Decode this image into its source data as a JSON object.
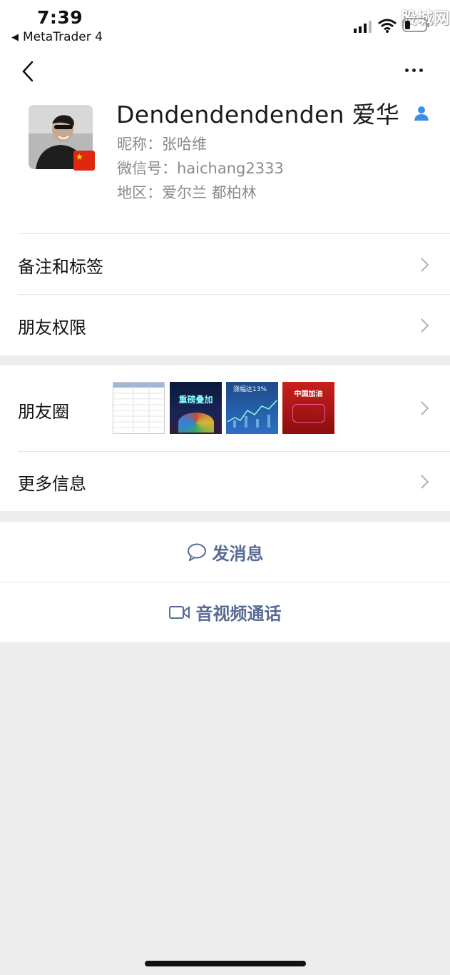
{
  "status_bar": {
    "time": "7:39",
    "back_app": "MetaTrader 4",
    "watermark": "股城网",
    "icons": [
      "signal-icon",
      "wifi-icon",
      "battery-icon"
    ]
  },
  "nav": {
    "back_icon": "chevron-left-icon",
    "more_icon": "more-dots-icon"
  },
  "profile": {
    "name": "Dendendendenden 爱华",
    "nickname": "昵称：张哈维",
    "wechat_id": "微信号：haichang2333",
    "region": "地区：爱尔兰 都柏林"
  },
  "rows": {
    "remarks": "备注和标签",
    "permissions": "朋友权限",
    "moments": "朋友圈",
    "more_info": "更多信息"
  },
  "moments_thumbs": {
    "thumb2_title": "重磅叠加",
    "thumb3_title": "涨幅达13%",
    "thumb4_title": "中国加油"
  },
  "actions": {
    "message": "发消息",
    "video_call": "音视频通话"
  },
  "colors": {
    "link": "#576b95",
    "background": "#ededed",
    "accent_person": "#3a8ee6"
  }
}
